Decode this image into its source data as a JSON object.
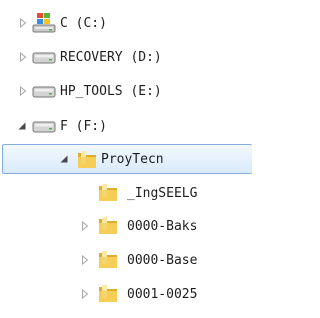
{
  "tree": {
    "drives": [
      {
        "label": "C (C:)",
        "icon": "windows-drive-icon",
        "expanded": false
      },
      {
        "label": "RECOVERY (D:)",
        "icon": "hard-drive-icon",
        "expanded": false
      },
      {
        "label": "HP_TOOLS (E:)",
        "icon": "hard-drive-icon",
        "expanded": false
      },
      {
        "label": "F (F:)",
        "icon": "hard-drive-icon",
        "expanded": true
      }
    ],
    "selected_folder": {
      "label": "ProyTecn",
      "icon": "folder-icon",
      "expanded": true
    },
    "subfolders": [
      {
        "label": "_IngSEELG",
        "icon": "folder-icon",
        "has_children": false
      },
      {
        "label": "0000-Baks",
        "icon": "folder-icon",
        "has_children": true
      },
      {
        "label": "0000-Base",
        "icon": "folder-icon",
        "has_children": true
      },
      {
        "label": "0001-0025",
        "icon": "folder-icon",
        "has_children": true
      }
    ]
  },
  "colors": {
    "selection_border": "#84acdd",
    "selection_fill": "#d9ebfb",
    "folder": "#f5cc52",
    "collapsed_arrow": "#a6a6a6",
    "expanded_arrow": "#464646"
  }
}
